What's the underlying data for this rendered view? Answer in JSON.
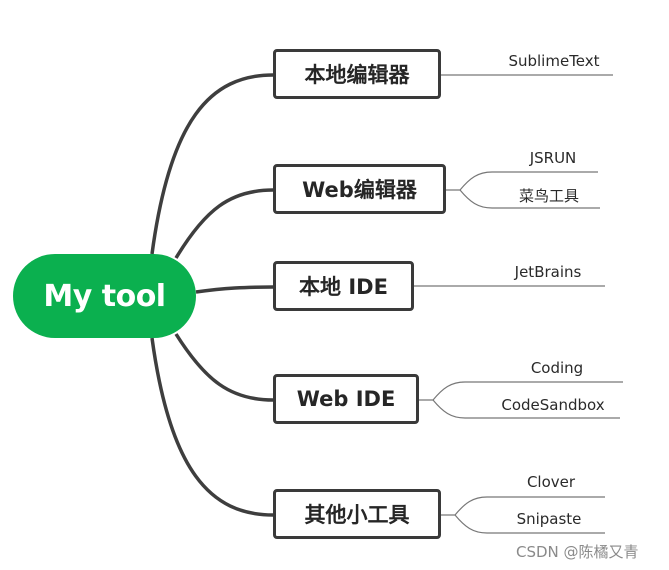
{
  "root": {
    "label": "My tool",
    "color": "#0bb04f"
  },
  "topics": [
    {
      "label": "本地编辑器",
      "children": [
        "SublimeText"
      ]
    },
    {
      "label": "Web编辑器",
      "children": [
        "JSRUN",
        "菜鸟工具"
      ]
    },
    {
      "label": "本地 IDE",
      "children": [
        "JetBrains"
      ]
    },
    {
      "label": "Web IDE",
      "children": [
        "Coding",
        "CodeSandbox"
      ]
    },
    {
      "label": "其他小工具",
      "children": [
        "Clover",
        "Snipaste"
      ]
    }
  ],
  "watermark": "CSDN @陈橘又青"
}
